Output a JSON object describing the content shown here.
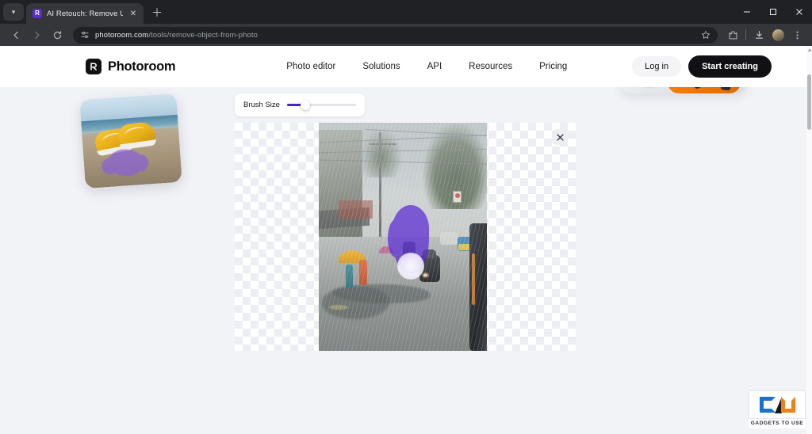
{
  "browser": {
    "tab": {
      "title": "AI Retouch: Remove Unwanted",
      "favicon_icon": "photoroom-favicon",
      "close_icon": "close-icon"
    },
    "tab_list_chevron_icon": "chevron-down-icon",
    "new_tab_icon": "plus-icon",
    "window_controls": {
      "minimize_icon": "minimize-icon",
      "maximize_icon": "maximize-icon",
      "close_icon": "close-icon"
    },
    "toolbar": {
      "back_icon": "back-arrow-icon",
      "forward_icon": "forward-arrow-icon",
      "reload_icon": "reload-icon",
      "site_settings_icon": "tune-settings-icon",
      "url_domain": "photoroom.com",
      "url_path": "/tools/remove-object-from-photo",
      "bookmark_icon": "star-icon",
      "extensions_icon": "puzzle-extension-icon",
      "downloads_icon": "download-icon",
      "profile_icon": "profile-avatar-icon",
      "menu_icon": "three-dot-menu-icon"
    }
  },
  "site": {
    "brand_name": "Photoroom",
    "brand_mark_icon": "photoroom-logo-icon",
    "nav": [
      {
        "label": "Photo editor"
      },
      {
        "label": "Solutions"
      },
      {
        "label": "API"
      },
      {
        "label": "Resources"
      },
      {
        "label": "Pricing"
      }
    ],
    "actions": {
      "login_label": "Log in",
      "start_label": "Start creating"
    }
  },
  "editor": {
    "brush": {
      "label": "Brush Size",
      "value_percent": 27,
      "fill_color": "#4b22d0",
      "track_color": "#e4e4ea",
      "thumb_color": "#ffffff"
    },
    "canvas": {
      "close_icon": "close-icon",
      "mask_color": "#5b2bd4",
      "mask_opacity": 0.72,
      "checker_color": "#eceef3"
    }
  },
  "watermark": {
    "text": "GADGETS TO USE",
    "logo_icon": "gadgets-to-use-logo-icon",
    "blue": "#1a73c8",
    "orange": "#f08013"
  },
  "scrollbar": {
    "up_arrow_icon": "scroll-up-arrow-icon"
  }
}
